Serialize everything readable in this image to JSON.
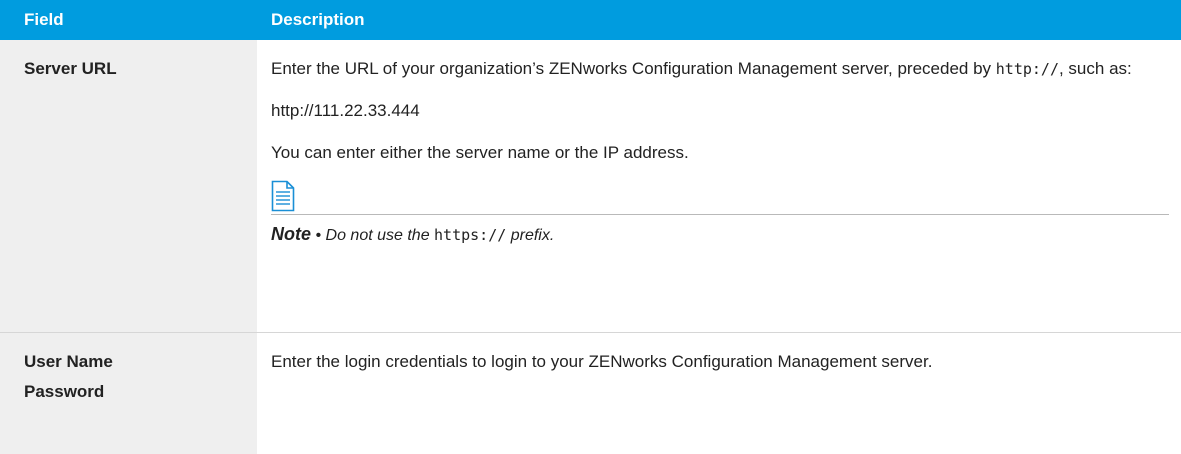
{
  "header": {
    "field": "Field",
    "description": "Description"
  },
  "rows": [
    {
      "field_lines": [
        "Server URL"
      ],
      "intro_part1": "Enter the URL of your organization’s ZENworks Configuration Management server, preceded by ",
      "intro_code": "http://",
      "intro_part2": ", such as:",
      "example_url": "http://111.22.33.444",
      "either_text": "You can enter either the server name or the IP address.",
      "note": {
        "label": "Note",
        "bullet": "•",
        "text_before": "Do not use the ",
        "code": "https://",
        "text_after": " prefix."
      }
    },
    {
      "field_lines": [
        "User Name",
        "Password"
      ],
      "description": "Enter the login credentials to login to your ZENworks Configuration Management server."
    }
  ],
  "colors": {
    "header_bg": "#009cdf",
    "field_bg": "#efefef",
    "note_icon": "#1a8fd6"
  },
  "icons": {
    "note": "document-note-icon"
  }
}
